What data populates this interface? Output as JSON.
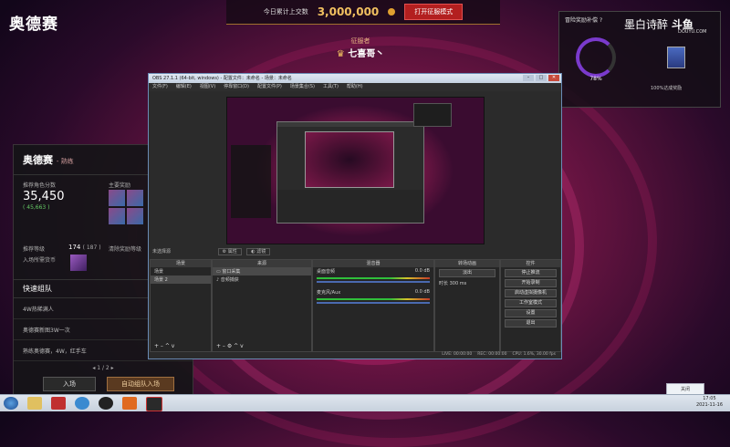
{
  "game": {
    "title": "奥德赛"
  },
  "banner": {
    "today_label": "今日累计上交数",
    "amount": "3,000,000",
    "button": "打开征服模式"
  },
  "conqueror": {
    "label": "征服者",
    "name": "七喜哥丶"
  },
  "watermark": {
    "name": "墨白诗醉",
    "brand": "斗鱼",
    "url": "DOUYU.COM"
  },
  "widget": {
    "title": "冒险奖励补偿",
    "help": "?",
    "percent": "78%",
    "caption": "100%达成奖励"
  },
  "left_panel": {
    "title": "奥德赛",
    "tag": "- 熟练",
    "score_label": "推荐角色分数",
    "score": "35,450",
    "score_sub": "( 45,663 )",
    "reward_label": "主要奖励",
    "grade_label": "推荐等级",
    "grade": "174",
    "grade_sub": "( 187 )",
    "entry_label": "入场所需货币",
    "status_label": "清除奖励等级",
    "quick_party": "快速组队",
    "rows": [
      {
        "label": "4W热稀满人",
        "value": "2 /"
      },
      {
        "label": "奥德赛新图3W一次",
        "value": "2 /"
      },
      {
        "label": "熟练奥德赛，4W，红手车",
        "value": "2 /"
      }
    ],
    "pager": "1 / 2",
    "enter_btn": "入场",
    "auto_btn": "自动组队入场"
  },
  "obs": {
    "title": "OBS 27.1.1 (64-bit, windows) - 配置文件：未命名 - 场景：未命名",
    "menu": [
      "文件(F)",
      "编辑(E)",
      "视图(V)",
      "停靠窗口(D)",
      "配置文件(P)",
      "场景集合(S)",
      "工具(T)",
      "帮助(H)"
    ],
    "no_source": "未选择源",
    "scene_tabs": [
      "属性",
      "滤镜"
    ],
    "docks": {
      "scenes": {
        "title": "场景",
        "items": [
          "场景",
          "场景 2"
        ]
      },
      "sources": {
        "title": "来源",
        "items": [
          "窗口采集",
          "音频捕获"
        ]
      },
      "mixer": {
        "title": "混音器",
        "tracks": [
          {
            "name": "桌面音频",
            "level": "0.0 dB"
          },
          {
            "name": "麦克风/Aux",
            "level": "0.0 dB"
          }
        ]
      },
      "transitions": {
        "title": "转场动画",
        "type": "淡出",
        "duration_label": "时长",
        "duration": "300 ms"
      },
      "controls": {
        "title": "控件",
        "buttons": [
          "停止推流",
          "开始录制",
          "启动虚拟摄像机",
          "工作室模式",
          "设置",
          "退出"
        ]
      }
    },
    "status": {
      "live": "LIVE: 00:00:00",
      "rec": "REC: 00:00:00",
      "cpu": "CPU: 1.6%, 30.00 fps"
    }
  },
  "taskbar": {
    "notify": "关闭",
    "time": "17:05",
    "date": "2021-11-16"
  },
  "colors": {
    "accent_red": "#b31f1f",
    "gold": "#f0c060",
    "obs_bg": "#2b2b2b"
  }
}
